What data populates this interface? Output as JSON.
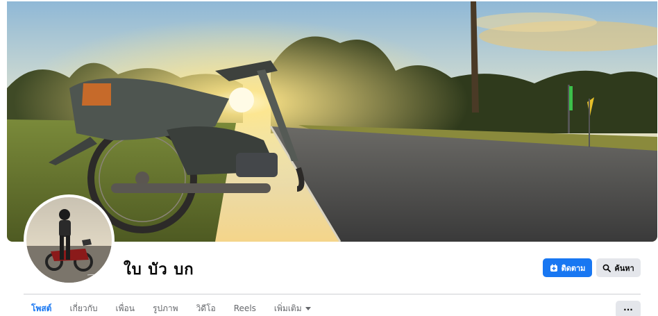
{
  "profile": {
    "name": "ใบ บัว บก"
  },
  "actions": {
    "follow_label": "ติดตาม",
    "search_label": "ค้นหา"
  },
  "tabs": [
    {
      "label": "โพสต์",
      "active": true
    },
    {
      "label": "เกี่ยวกับ",
      "active": false
    },
    {
      "label": "เพื่อน",
      "active": false
    },
    {
      "label": "รูปภาพ",
      "active": false
    },
    {
      "label": "วิดีโอ",
      "active": false
    },
    {
      "label": "Reels",
      "active": false
    },
    {
      "label": "เพิ่มเติม",
      "active": false
    }
  ],
  "more_options_label": "···",
  "colors": {
    "accent": "#1877f2",
    "button_grey": "#e4e6eb",
    "text_secondary": "#65676b"
  },
  "icons": {
    "follow": "follow-plus-icon",
    "search": "search-icon",
    "tab_more": "caret-down-icon"
  }
}
